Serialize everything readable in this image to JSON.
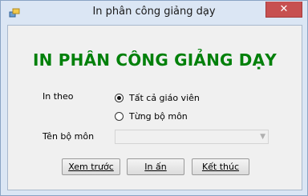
{
  "window": {
    "title": "In phân công giảng dạy",
    "close_symbol": "✕"
  },
  "form": {
    "heading": "IN PHÂN CÔNG GIẢNG DẠY",
    "in_theo_label": "In theo",
    "radio_all": "Tất cả giáo viên",
    "radio_dept": "Từng bộ môn",
    "selected": "radio_all",
    "ten_bo_mon_label": "Tên bộ môn",
    "combo_value": ""
  },
  "buttons": {
    "preview": "Xem trước",
    "print": "In ấn",
    "exit": "Kết thúc"
  },
  "colors": {
    "heading": "#00800a",
    "close": "#c75050"
  }
}
